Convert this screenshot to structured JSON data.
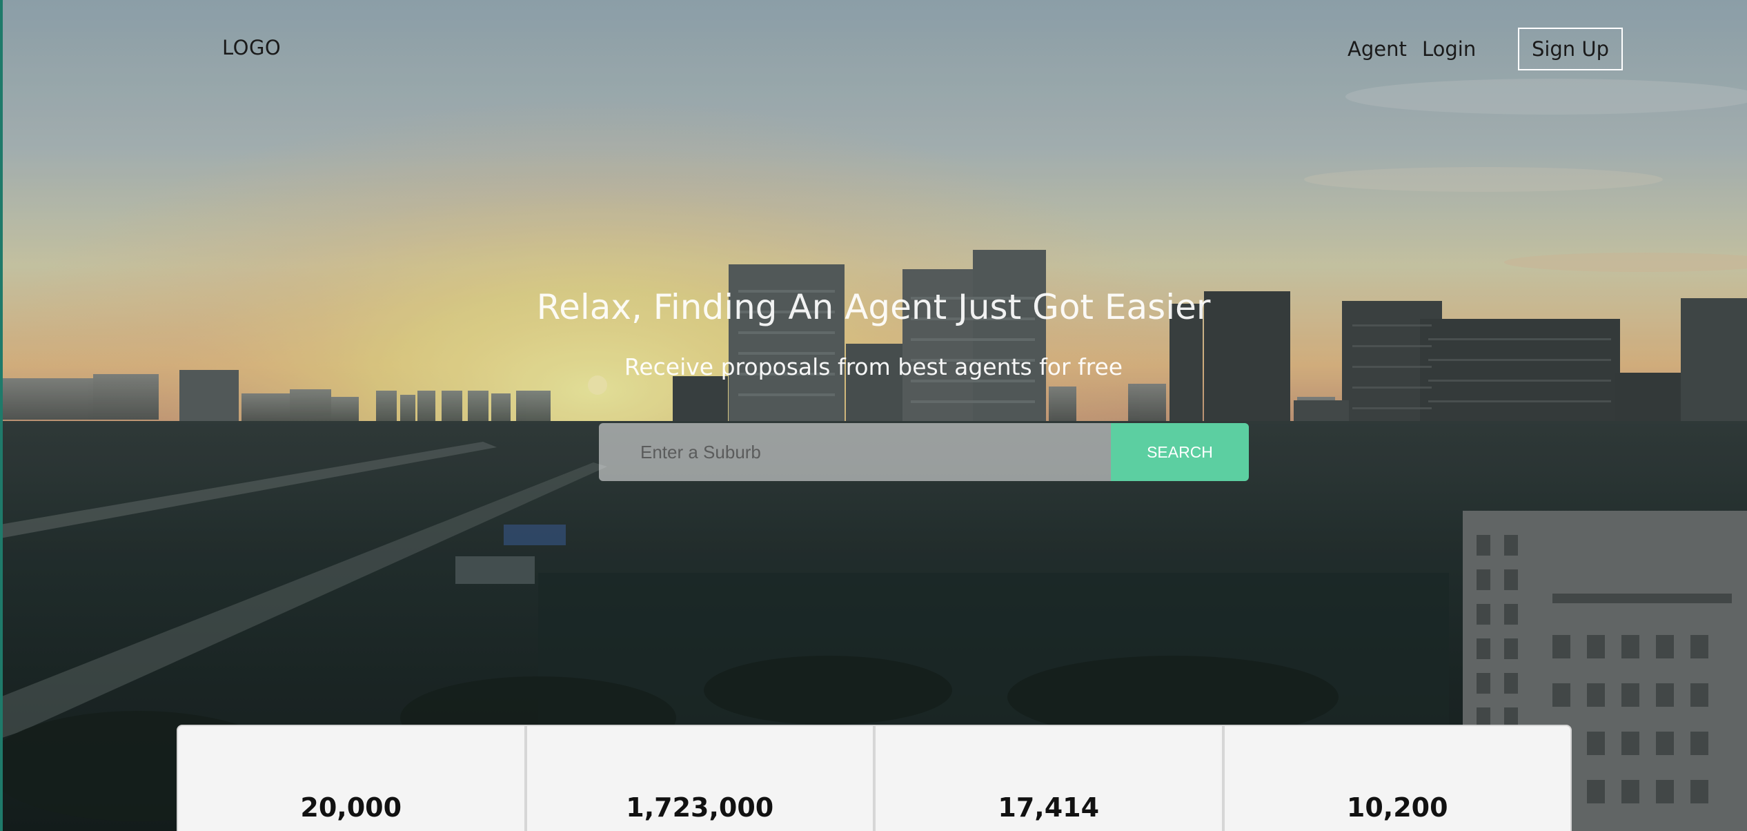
{
  "brand": {
    "logo_text": "LOGO"
  },
  "nav": {
    "agent_label": "Agent",
    "login_label": "Login",
    "signup_label": "Sign Up"
  },
  "hero": {
    "title": "Relax, Finding An Agent Just Got Easier",
    "subtitle": "Receive proposals from best agents for free"
  },
  "search": {
    "placeholder": "Enter a Suburb",
    "value": "",
    "button_label": "SEARCH"
  },
  "stats": [
    {
      "value": "20,000"
    },
    {
      "value": "1,723,000"
    },
    {
      "value": "17,414"
    },
    {
      "value": "10,200"
    }
  ],
  "colors": {
    "accent": "#5ccfa1",
    "sky_top": "#9fb3bd",
    "sunset": "#f5f0a0",
    "ground": "#1b2626"
  },
  "icons": []
}
